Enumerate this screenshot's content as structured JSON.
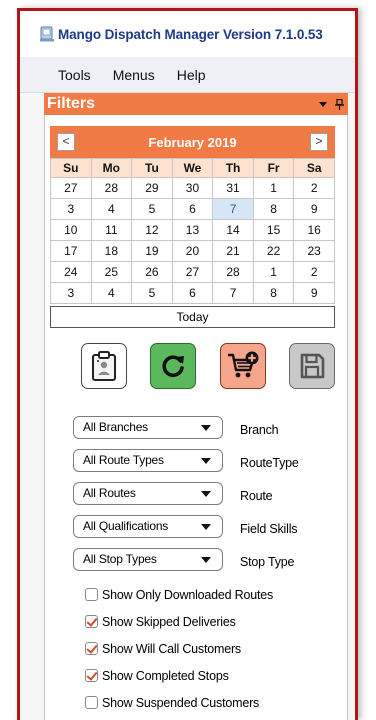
{
  "window": {
    "title": "Mango Dispatch Manager Version 7.1.0.53",
    "app_icon": "mango-app-icon"
  },
  "menu": {
    "items": [
      "Tools",
      "Menus",
      "Help"
    ]
  },
  "filters_panel": {
    "title": "Filters",
    "controls": [
      "dropdown-arrow-icon",
      "pin-icon"
    ]
  },
  "calendar": {
    "month_label": "February 2019",
    "prev": "<",
    "next": ">",
    "weekdays": [
      "Su",
      "Mo",
      "Tu",
      "We",
      "Th",
      "Fr",
      "Sa"
    ],
    "weeks": [
      [
        "27",
        "28",
        "29",
        "30",
        "31",
        "1",
        "2"
      ],
      [
        "3",
        "4",
        "5",
        "6",
        "7",
        "8",
        "9"
      ],
      [
        "10",
        "11",
        "12",
        "13",
        "14",
        "15",
        "16"
      ],
      [
        "17",
        "18",
        "19",
        "20",
        "21",
        "22",
        "23"
      ],
      [
        "24",
        "25",
        "26",
        "27",
        "28",
        "1",
        "2"
      ],
      [
        "3",
        "4",
        "5",
        "6",
        "7",
        "8",
        "9"
      ]
    ],
    "selected_date": "7",
    "today_label": "Today"
  },
  "action_buttons": [
    {
      "icon": "clipboard-report-icon",
      "color": "#ffffff"
    },
    {
      "icon": "refresh-icon",
      "color": "#5cb85c"
    },
    {
      "icon": "add-to-cart-icon",
      "color": "#f6a58c"
    },
    {
      "icon": "save-icon",
      "color": "#c8c8c8"
    }
  ],
  "filter_selects": [
    {
      "value": "All Branches",
      "label": "Branch"
    },
    {
      "value": "All Route Types",
      "label": "RouteType"
    },
    {
      "value": "All Routes",
      "label": "Route"
    },
    {
      "value": "All Qualifications",
      "label": "Field Skills"
    },
    {
      "value": "All Stop Types",
      "label": "Stop Type"
    }
  ],
  "checkboxes": [
    {
      "label": "Show Only Downloaded Routes",
      "checked": false
    },
    {
      "label": "Show Skipped Deliveries",
      "checked": true
    },
    {
      "label": "Show Will Call Customers",
      "checked": true
    },
    {
      "label": "Show Completed Stops",
      "checked": true
    },
    {
      "label": "Show Suspended Customers",
      "checked": false
    }
  ],
  "colors": {
    "accent": "#f27a45",
    "title_text": "#1f3a86",
    "window_border": "#b3151c",
    "weekday_header_bg": "#fde3cf"
  }
}
